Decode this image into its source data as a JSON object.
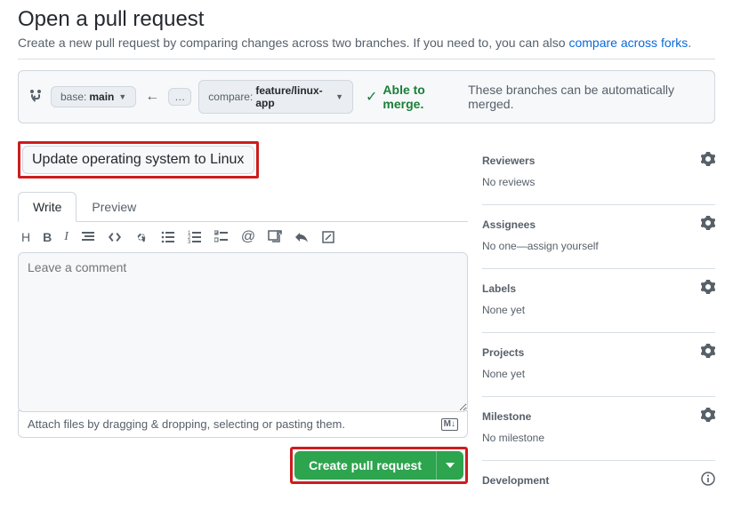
{
  "header": {
    "title": "Open a pull request",
    "subtitle_prefix": "Create a new pull request by comparing changes across two branches. If you need to, you can also ",
    "subtitle_link": "compare across forks",
    "subtitle_suffix": "."
  },
  "branch_bar": {
    "base_label": "base: ",
    "base_value": "main",
    "compare_label": "compare: ",
    "compare_value": "feature/linux-app",
    "merge_able": "Able to merge.",
    "merge_msg": "These branches can be automatically merged."
  },
  "form": {
    "title_value": "Update operating system to Linux",
    "tabs": {
      "write": "Write",
      "preview": "Preview"
    },
    "comment_placeholder": "Leave a comment",
    "attach_hint": "Attach files by dragging & dropping, selecting or pasting them.",
    "md_badge": "M↓",
    "create_button": "Create pull request"
  },
  "sidebar": {
    "reviewers": {
      "title": "Reviewers",
      "value": "No reviews"
    },
    "assignees": {
      "title": "Assignees",
      "prefix": "No one—",
      "link": "assign yourself"
    },
    "labels": {
      "title": "Labels",
      "value": "None yet"
    },
    "projects": {
      "title": "Projects",
      "value": "None yet"
    },
    "milestone": {
      "title": "Milestone",
      "value": "No milestone"
    },
    "development": {
      "title": "Development"
    }
  }
}
